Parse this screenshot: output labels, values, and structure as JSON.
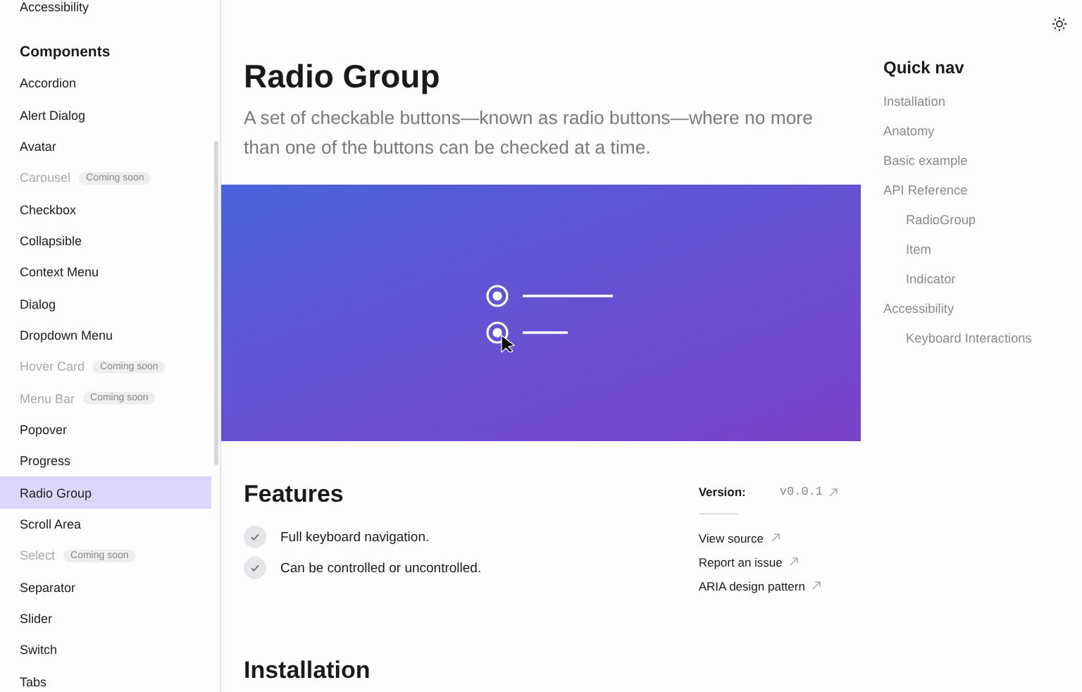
{
  "sidebar": {
    "top_item": "Accessibility",
    "heading": "Components",
    "items": [
      {
        "label": "Accordion",
        "disabled": false,
        "selected": false
      },
      {
        "label": "Alert Dialog",
        "disabled": false,
        "selected": false
      },
      {
        "label": "Avatar",
        "disabled": false,
        "selected": false
      },
      {
        "label": "Carousel",
        "disabled": true,
        "badge": "Coming soon",
        "selected": false
      },
      {
        "label": "Checkbox",
        "disabled": false,
        "selected": false
      },
      {
        "label": "Collapsible",
        "disabled": false,
        "selected": false
      },
      {
        "label": "Context Menu",
        "disabled": false,
        "selected": false
      },
      {
        "label": "Dialog",
        "disabled": false,
        "selected": false
      },
      {
        "label": "Dropdown Menu",
        "disabled": false,
        "selected": false
      },
      {
        "label": "Hover Card",
        "disabled": true,
        "badge": "Coming soon",
        "selected": false
      },
      {
        "label": "Menu Bar",
        "disabled": true,
        "badge": "Coming soon",
        "selected": false
      },
      {
        "label": "Popover",
        "disabled": false,
        "selected": false
      },
      {
        "label": "Progress",
        "disabled": false,
        "selected": false
      },
      {
        "label": "Radio Group",
        "disabled": false,
        "selected": true
      },
      {
        "label": "Scroll Area",
        "disabled": false,
        "selected": false
      },
      {
        "label": "Select",
        "disabled": true,
        "badge": "Coming soon",
        "selected": false
      },
      {
        "label": "Separator",
        "disabled": false,
        "selected": false
      },
      {
        "label": "Slider",
        "disabled": false,
        "selected": false
      },
      {
        "label": "Switch",
        "disabled": false,
        "selected": false
      },
      {
        "label": "Tabs",
        "disabled": false,
        "selected": false
      }
    ]
  },
  "page": {
    "title": "Radio Group",
    "description": "A set of checkable buttons—known as radio buttons—where no more than one of the buttons can be checked at a time.",
    "features_heading": "Features",
    "features": [
      "Full keyboard navigation.",
      "Can be controlled or uncontrolled."
    ],
    "installation_heading": "Installation"
  },
  "meta": {
    "version_label": "Version:",
    "version": "v0.0.1",
    "links": [
      "View source",
      "Report an issue",
      "ARIA design pattern"
    ]
  },
  "quick_nav": {
    "heading": "Quick nav",
    "items": [
      {
        "label": "Installation"
      },
      {
        "label": "Anatomy"
      },
      {
        "label": "Basic example"
      },
      {
        "label": "API Reference",
        "children": [
          {
            "label": "RadioGroup"
          },
          {
            "label": "Item"
          },
          {
            "label": "Indicator"
          }
        ]
      },
      {
        "label": "Accessibility",
        "children": [
          {
            "label": "Keyboard Interactions"
          }
        ]
      }
    ]
  }
}
